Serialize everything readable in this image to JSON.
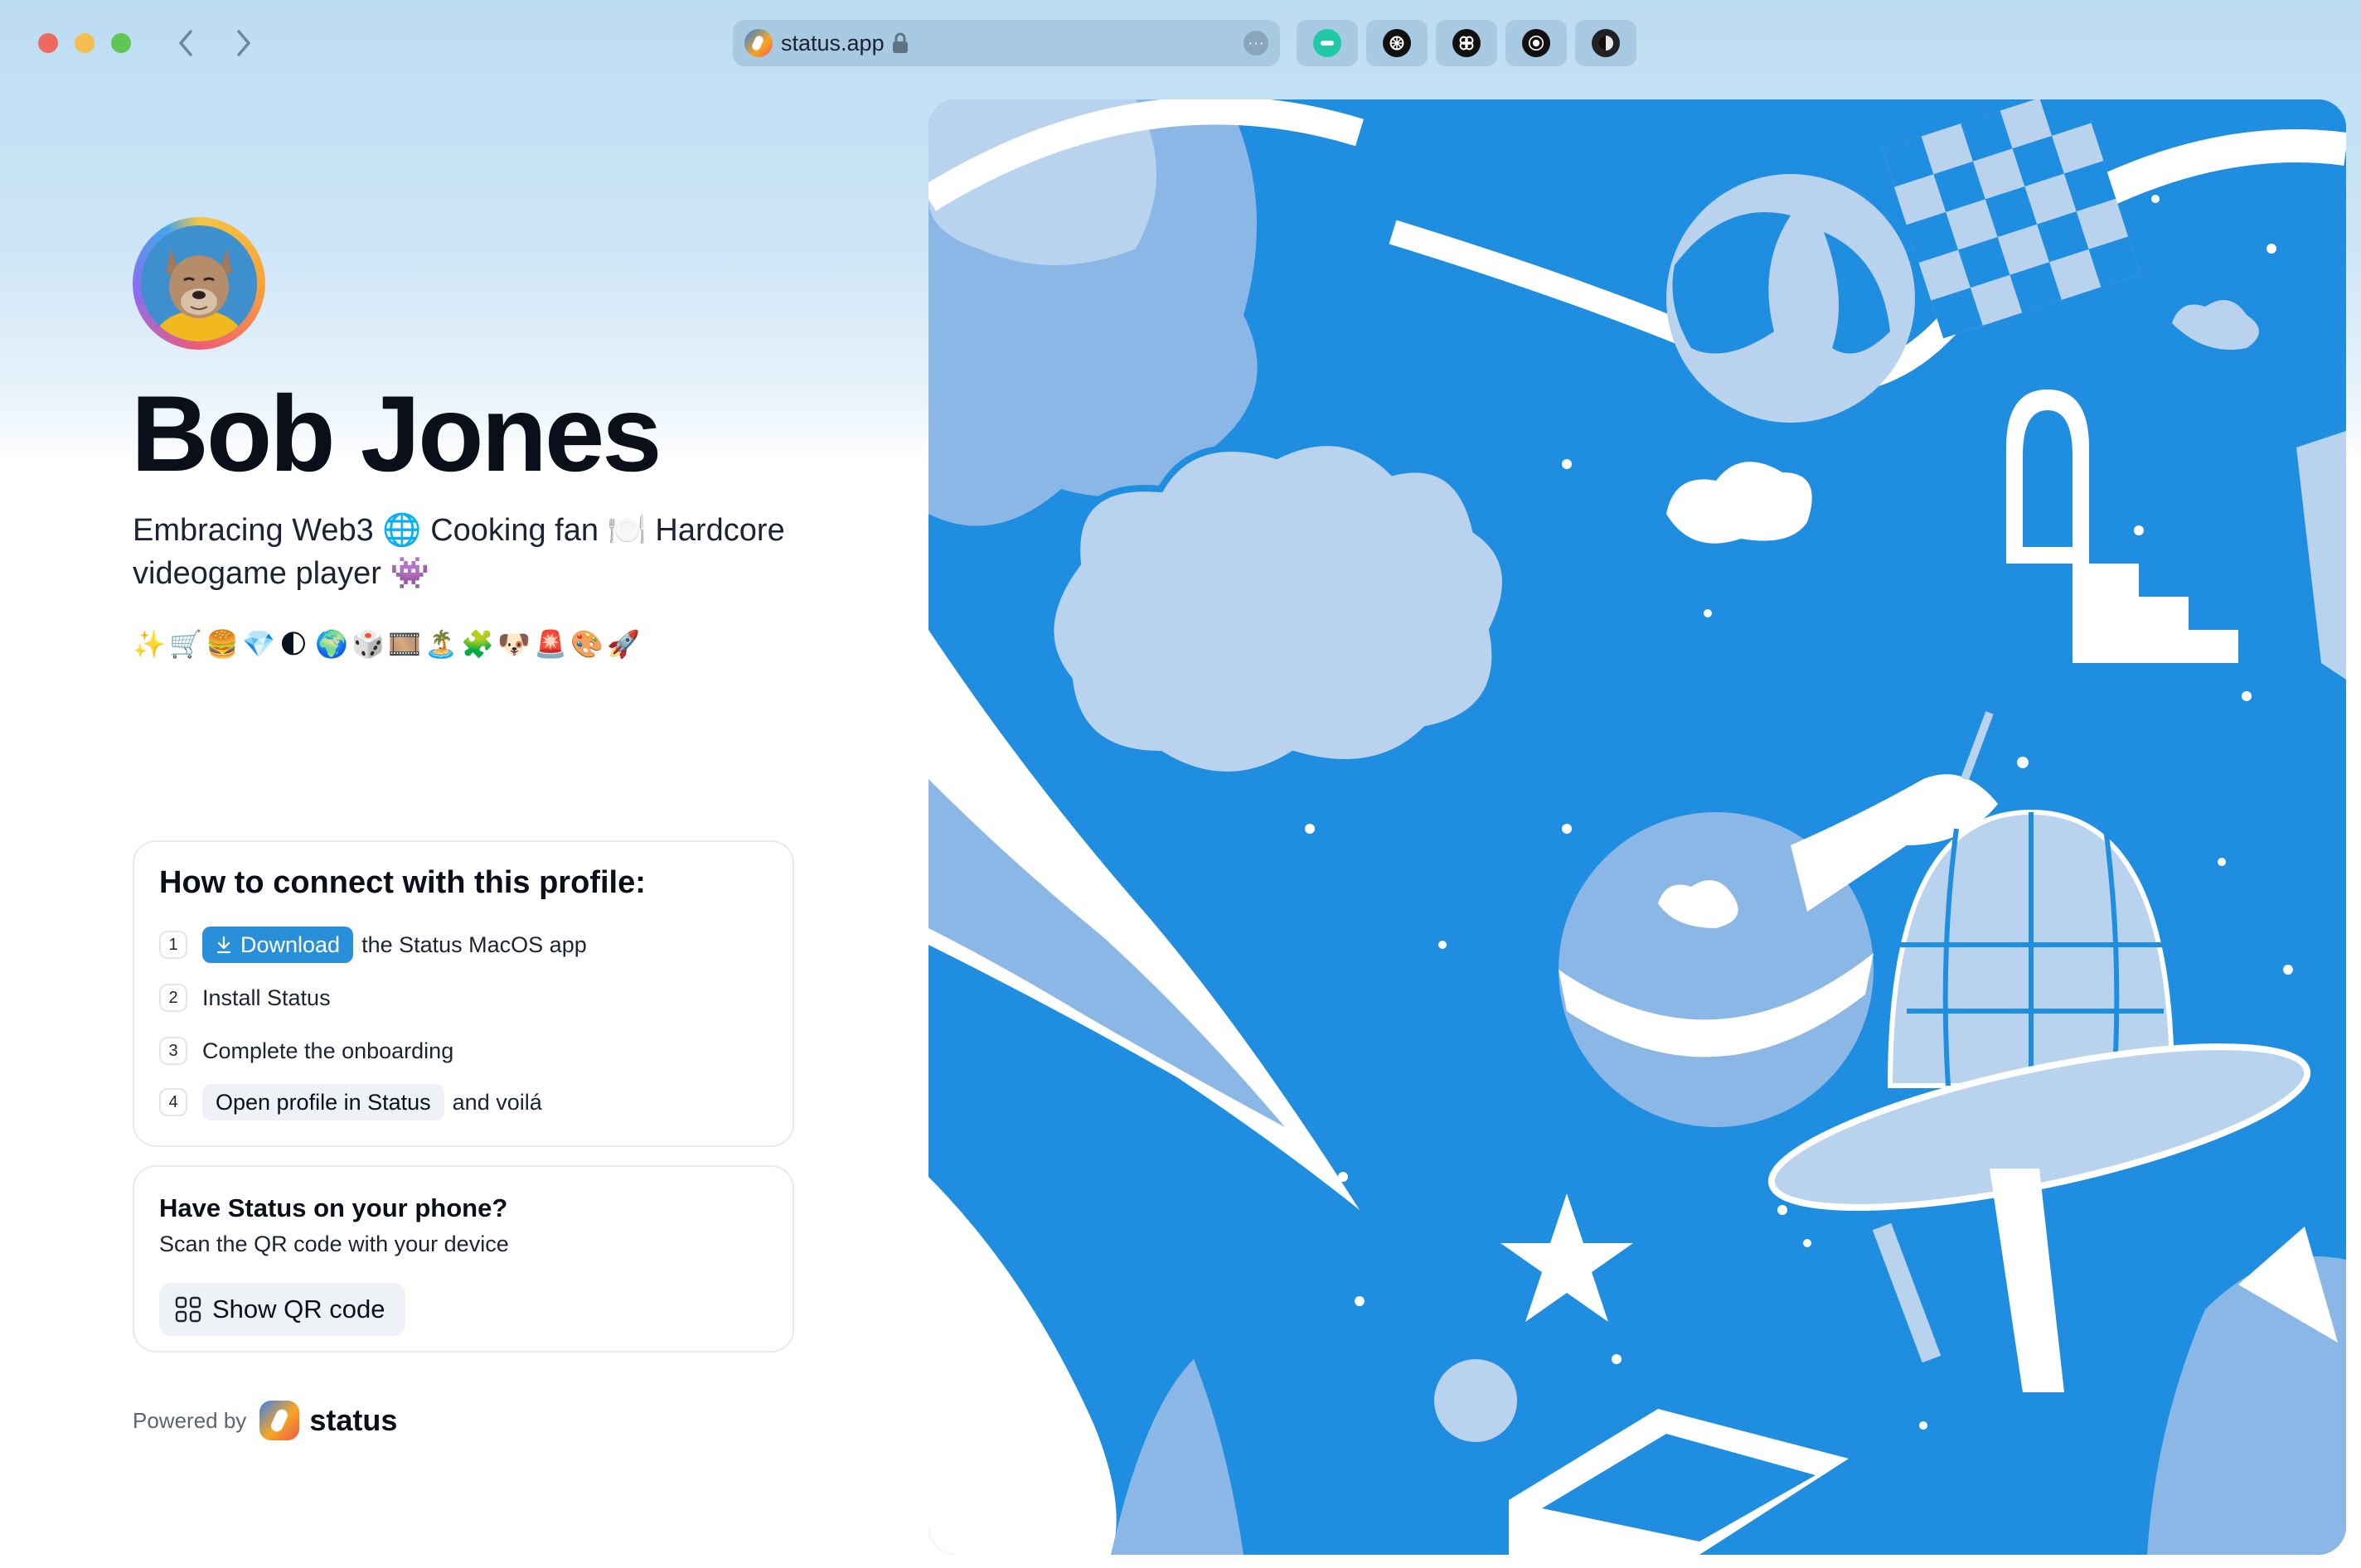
{
  "browser": {
    "url": "status.app",
    "icons": {
      "favicon": "status-logo-icon",
      "lock": "lock-icon",
      "more": "more-options-icon",
      "back": "chevron-left-icon",
      "forward": "chevron-right-icon"
    },
    "extensions": [
      "keycard-extension-icon",
      "openai-extension-icon",
      "extension-icon-3",
      "extension-icon-4",
      "extension-icon-5"
    ]
  },
  "profile": {
    "name": "Bob Jones",
    "bio": "Embracing Web3 🌐 Cooking fan 🍽️ Hardcore videogame player 👾",
    "emojis": [
      "✨",
      "🛒",
      "🍔",
      "💎",
      "🌓",
      "🌍",
      "🎲",
      "🎞️",
      "🏝️",
      "🧩",
      "🐶",
      "🚨",
      "🎨",
      "🚀"
    ]
  },
  "connect": {
    "title": "How to connect with this profile:",
    "steps": [
      {
        "num": "1",
        "button": "Download",
        "text": "the Status MacOS app"
      },
      {
        "num": "2",
        "text": "Install Status"
      },
      {
        "num": "3",
        "text": "Complete the onboarding"
      },
      {
        "num": "4",
        "button": "Open profile in Status",
        "text": "and voilá"
      }
    ]
  },
  "phone": {
    "title": "Have Status on your phone?",
    "subtitle": "Scan the QR code with your device",
    "button": "Show QR code"
  },
  "footer": {
    "powered_by": "Powered by",
    "brand": "status"
  },
  "colors": {
    "accent": "#2a8fd9",
    "art_blue": "#1f8ee0",
    "art_light": "#b9d3ee"
  }
}
